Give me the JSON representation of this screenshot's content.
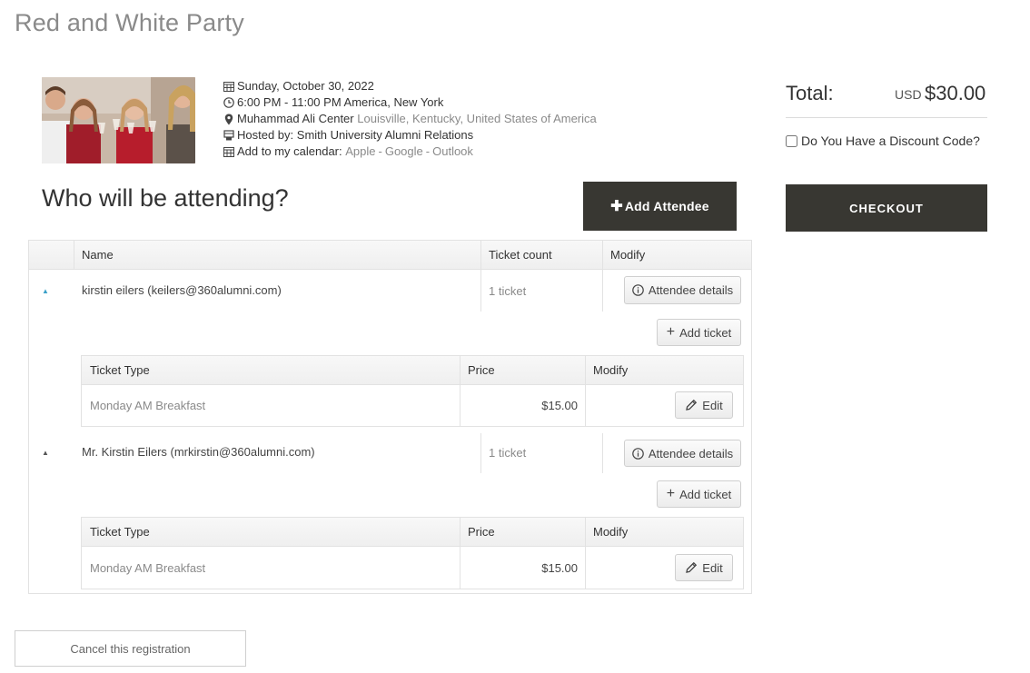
{
  "event": {
    "title": "Red and White Party",
    "date": "Sunday, October 30, 2022",
    "time": "6:00 PM - 11:00 PM America, New York",
    "venue": "Muhammad Ali Center",
    "location": "Louisville, Kentucky, United States of America",
    "host_prefix": "Hosted by:",
    "host": "Smith University Alumni Relations",
    "calendar_prefix": "Add to my calendar:",
    "calendar_links": [
      "Apple",
      "Google",
      "Outlook"
    ],
    "calendar_separator": "-"
  },
  "attending": {
    "heading": "Who will be attending?",
    "add_attendee_label": "Add Attendee"
  },
  "summary": {
    "total_label": "Total:",
    "currency": "USD",
    "amount": "$30.00",
    "discount_label": "Do You Have a Discount Code?",
    "checkout_label": "CHECKOUT"
  },
  "table": {
    "columns": [
      "Name",
      "Ticket count",
      "Modify"
    ],
    "attendees": [
      {
        "name": "kirstin eilers (keilers@360alumni.com)",
        "ticket_count": "1 ticket",
        "details_label": "Attendee details",
        "add_ticket_label": "Add ticket",
        "sub_columns": [
          "Ticket Type",
          "Price",
          "Modify"
        ],
        "tickets": [
          {
            "type": "Monday AM Breakfast",
            "price": "$15.00",
            "edit_label": "Edit"
          }
        ]
      },
      {
        "name": "Mr. Kirstin Eilers (mrkirstin@360alumni.com)",
        "ticket_count": "1 ticket",
        "details_label": "Attendee details",
        "add_ticket_label": "Add ticket",
        "sub_columns": [
          "Ticket Type",
          "Price",
          "Modify"
        ],
        "tickets": [
          {
            "type": "Monday AM Breakfast",
            "price": "$15.00",
            "edit_label": "Edit"
          }
        ]
      }
    ]
  },
  "footer": {
    "cancel_label": "Cancel this registration"
  },
  "colors": {
    "dark_button": "#383732",
    "link_gray": "#8a8a8a",
    "caret_blue": "#3aa0c8"
  }
}
